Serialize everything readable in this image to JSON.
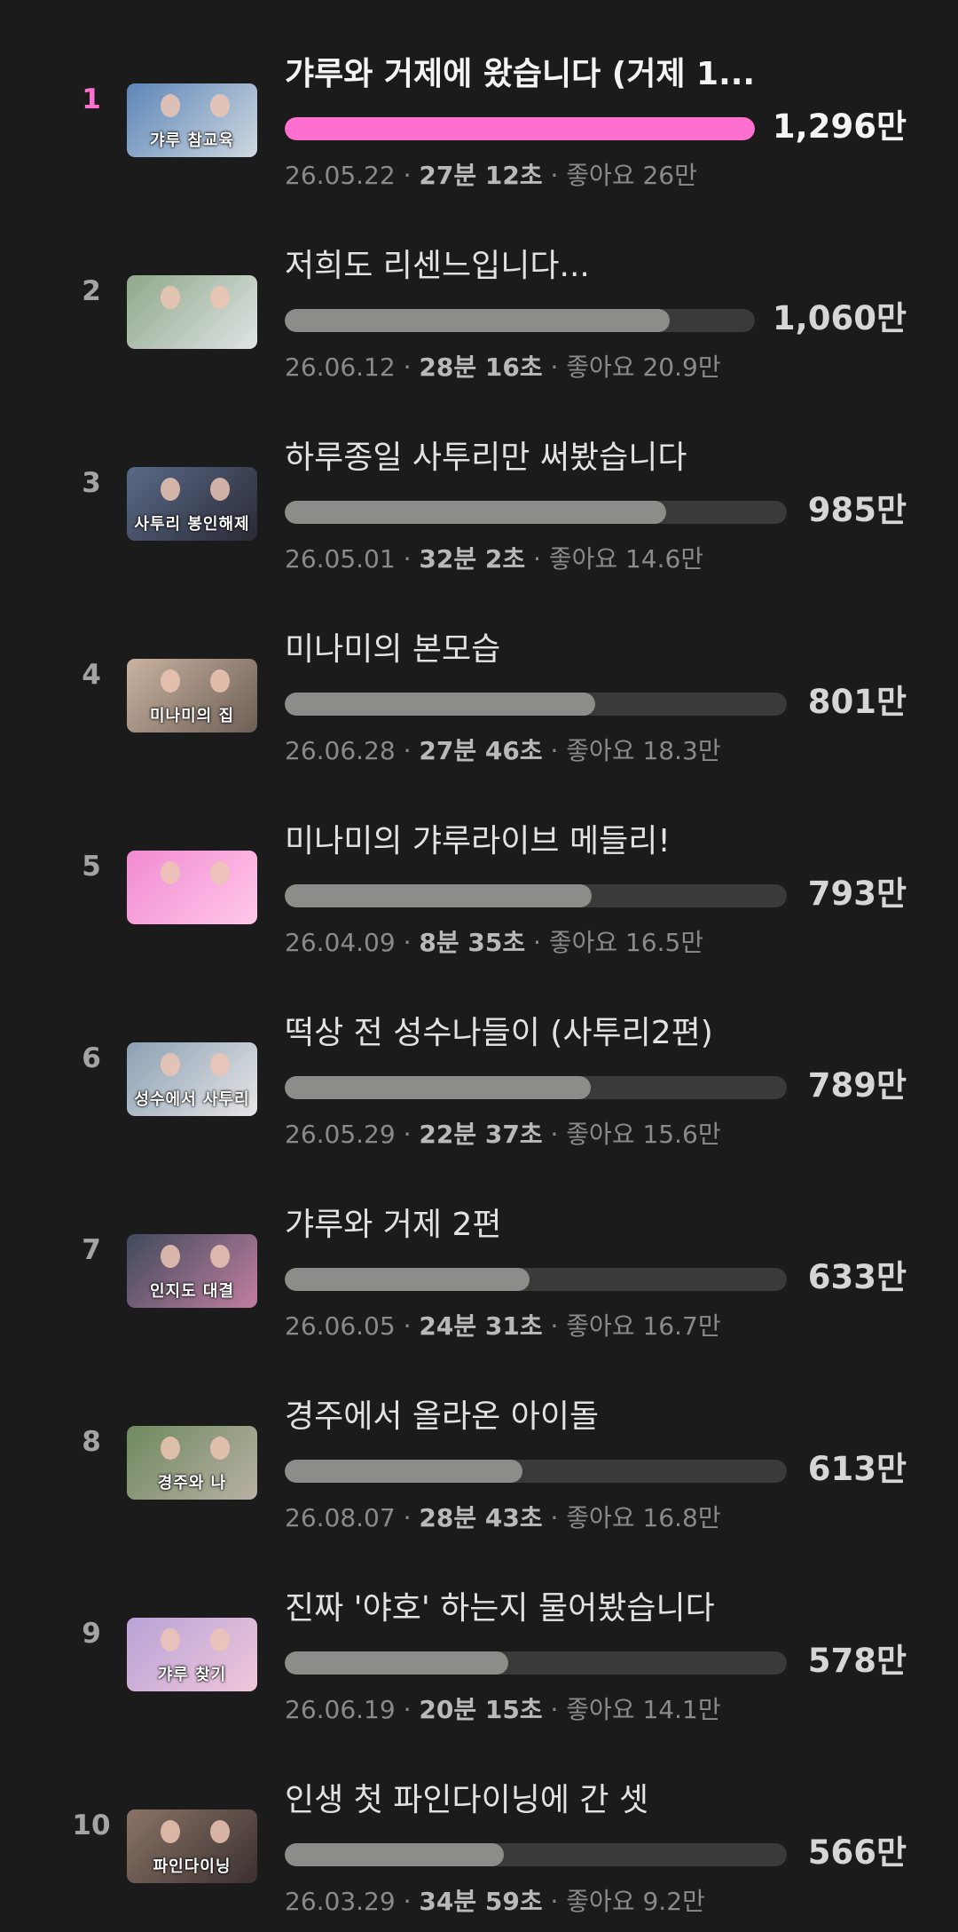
{
  "accent_color": "#ff6fcf",
  "bar_color": "#8c8c88",
  "videos": [
    {
      "rank": "1",
      "title": "갸루와 거제에 왔습니다 (거제 1...",
      "date": "26.05.22",
      "duration": "27분 12초",
      "likes": "좋아요 26만",
      "views": "1,296만",
      "progress": 1.0,
      "thumb": {
        "caption": "갸루 참교육",
        "bg": [
          "#5d86b8",
          "#cfd8e0"
        ]
      }
    },
    {
      "rank": "2",
      "title": "저희도 리센느입니다...",
      "date": "26.06.12",
      "duration": "28분 16초",
      "likes": "좋아요 20.9만",
      "views": "1,060만",
      "progress": 0.818,
      "thumb": {
        "caption": "",
        "bg": [
          "#8fa88a",
          "#dfe4e4"
        ]
      }
    },
    {
      "rank": "3",
      "title": "하루종일 사투리만 써봤습니다",
      "date": "26.05.01",
      "duration": "32분 2초",
      "likes": "좋아요 14.6만",
      "views": "985만",
      "progress": 0.76,
      "thumb": {
        "caption": "사투리 봉인해제",
        "bg": [
          "#5a6a88",
          "#2a2a35"
        ]
      }
    },
    {
      "rank": "4",
      "title": "미나미의 본모습",
      "date": "26.06.28",
      "duration": "27분 46초",
      "likes": "좋아요 18.3만",
      "views": "801만",
      "progress": 0.618,
      "thumb": {
        "caption": "미나미의 집",
        "bg": [
          "#c9b3a0",
          "#6d5e55"
        ]
      }
    },
    {
      "rank": "5",
      "title": "미나미의 갸루라이브 메들리!",
      "date": "26.04.09",
      "duration": "8분 35초",
      "likes": "좋아요 16.5만",
      "views": "793만",
      "progress": 0.612,
      "thumb": {
        "caption": "",
        "bg": [
          "#f28ad1",
          "#ffc8ea"
        ]
      }
    },
    {
      "rank": "6",
      "title": "떡상 전 성수나들이 (사투리2편)",
      "date": "26.05.29",
      "duration": "22분 37초",
      "likes": "좋아요 15.6만",
      "views": "789만",
      "progress": 0.609,
      "thumb": {
        "caption": "성수에서 사투리",
        "bg": [
          "#8ca0b4",
          "#e6e6e6"
        ]
      }
    },
    {
      "rank": "7",
      "title": "갸루와 거제 2편",
      "date": "26.06.05",
      "duration": "24분 31초",
      "likes": "좋아요 16.7만",
      "views": "633만",
      "progress": 0.488,
      "thumb": {
        "caption": "인지도 대결",
        "bg": [
          "#3f4a5c",
          "#c27fa0"
        ]
      }
    },
    {
      "rank": "8",
      "title": "경주에서 올라온 아이돌",
      "date": "26.08.07",
      "duration": "28분 43초",
      "likes": "좋아요 16.8만",
      "views": "613만",
      "progress": 0.473,
      "thumb": {
        "caption": "경주와 나",
        "bg": [
          "#6f8a5f",
          "#b8b0a4"
        ]
      }
    },
    {
      "rank": "9",
      "title": "진짜 '야호' 하는지 물어봤습니다",
      "date": "26.06.19",
      "duration": "20분 15초",
      "likes": "좋아요 14.1만",
      "views": "578만",
      "progress": 0.446,
      "thumb": {
        "caption": "갸루 찾기",
        "bg": [
          "#b9a3d8",
          "#f0c6da"
        ]
      }
    },
    {
      "rank": "10",
      "title": "인생 첫 파인다이닝에 간 셋",
      "date": "26.03.29",
      "duration": "34분 59초",
      "likes": "좋아요 9.2만",
      "views": "566만",
      "progress": 0.437,
      "thumb": {
        "caption": "파인다이닝",
        "bg": [
          "#8a7466",
          "#3b3030"
        ]
      }
    }
  ]
}
